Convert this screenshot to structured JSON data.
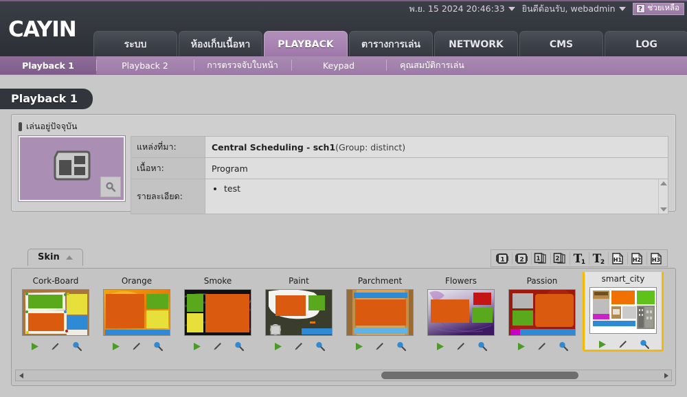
{
  "header": {
    "logo_text": "CAYIN",
    "datetime": "พ.ย. 15 2024 20:46:33",
    "welcome": "ยินดีต้อนรับ, webadmin",
    "help_label": "ช่วยเหลือ",
    "help_mark": "?"
  },
  "main_tabs": [
    {
      "label": "ระบบ",
      "active": false
    },
    {
      "label": "ห้องเก็บเนื้อหา",
      "active": false
    },
    {
      "label": "PLAYBACK",
      "active": true
    },
    {
      "label": "ตารางการเล่น",
      "active": false
    },
    {
      "label": "NETWORK",
      "active": false
    },
    {
      "label": "CMS",
      "active": false
    },
    {
      "label": "LOG",
      "active": false
    }
  ],
  "sub_tabs": [
    {
      "label": "Playback 1",
      "active": true
    },
    {
      "label": "Playback 2",
      "active": false
    },
    {
      "label": "การตรวจจับใบหน้า",
      "active": false
    },
    {
      "label": "Keypad",
      "active": false
    },
    {
      "label": "คุณสมบัติการเล่น",
      "active": false
    }
  ],
  "page_title": "Playback 1",
  "now_playing": {
    "section_title": "เล่นอยู่ปัจจุบัน",
    "rows": [
      {
        "label": "แหล่งที่มา:",
        "value_strong": "Central Scheduling - sch1",
        "value_rest": " (Group: distinct)"
      },
      {
        "label": "เนื้อหา:",
        "value_strong": "",
        "value_rest": "Program"
      }
    ],
    "detail_label": "รายละเอียด:",
    "detail_items": [
      "test"
    ]
  },
  "skin_section": {
    "tab_label": "Skin",
    "toolbar": [
      {
        "name": "media-1-icon",
        "glyph": "1",
        "kind": "camera"
      },
      {
        "name": "media-2-icon",
        "glyph": "2",
        "kind": "camera"
      },
      {
        "name": "picture-1-icon",
        "glyph": "1",
        "kind": "pages"
      },
      {
        "name": "picture-2-icon",
        "glyph": "2",
        "kind": "pages"
      },
      {
        "name": "ticker-1-icon",
        "glyph": "T",
        "sub": "1",
        "kind": "text"
      },
      {
        "name": "ticker-2-icon",
        "glyph": "T",
        "sub": "2",
        "kind": "text"
      },
      {
        "name": "html-1-icon",
        "glyph": "H1",
        "kind": "doc"
      },
      {
        "name": "html-2-icon",
        "glyph": "H2",
        "kind": "doc"
      },
      {
        "name": "html-3-icon",
        "glyph": "H3",
        "kind": "doc"
      }
    ],
    "actions": {
      "play": "play-icon",
      "edit": "edit-pencil-icon",
      "preview": "magnifier-icon"
    },
    "skins": [
      {
        "name": "Cork-Board",
        "selected": false
      },
      {
        "name": "Orange",
        "selected": false
      },
      {
        "name": "Smoke",
        "selected": false
      },
      {
        "name": "Paint",
        "selected": false
      },
      {
        "name": "Parchment",
        "selected": false
      },
      {
        "name": "Flowers",
        "selected": false
      },
      {
        "name": "Passion",
        "selected": false
      },
      {
        "name": "smart_city",
        "selected": true
      }
    ]
  },
  "colors": {
    "accent_purple": "#a882b2",
    "dark_header": "#33363d",
    "selection_orange": "#f7b900",
    "page_bg": "#c8c8c8"
  }
}
